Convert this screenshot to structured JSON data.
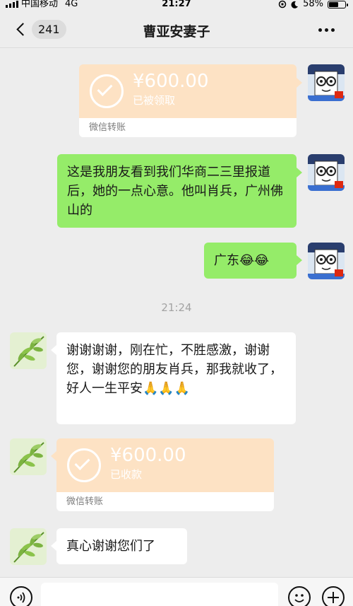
{
  "status_bar": {
    "carrier": "中国移动",
    "network": "4G",
    "time": "21:27",
    "battery_percent": "58%",
    "battery_level": 0.58
  },
  "header": {
    "unread_count": "241",
    "title": "曹亚安妻子"
  },
  "messages": {
    "m1": {
      "amount": "¥600.00",
      "status": "已被领取",
      "label": "微信转账"
    },
    "m2": {
      "text": "这是我朋友看到我们华商二三里报道后，她的一点心意。他叫肖兵，广州佛山的"
    },
    "m3": {
      "text": "广东😂😂"
    },
    "time_divider": "21:24",
    "m4": {
      "text": "谢谢谢谢，刚在忙，不胜感激，谢谢您，谢谢您的朋友肖兵，那我就收了，好人一生平安🙏🙏🙏"
    },
    "m5": {
      "amount": "¥600.00",
      "status": "已收款",
      "label": "微信转账"
    },
    "m6": {
      "text": "真心谢谢您们了"
    }
  },
  "colors": {
    "sent_bubble": "#95ec69",
    "received_bubble": "#ffffff",
    "transfer_card": "#fde2c4",
    "background": "#ededed"
  },
  "icons": {
    "back": "chevron-left-icon",
    "more": "more-dots-icon",
    "voice": "voice-icon",
    "emoji": "emoji-icon",
    "add": "plus-icon"
  }
}
